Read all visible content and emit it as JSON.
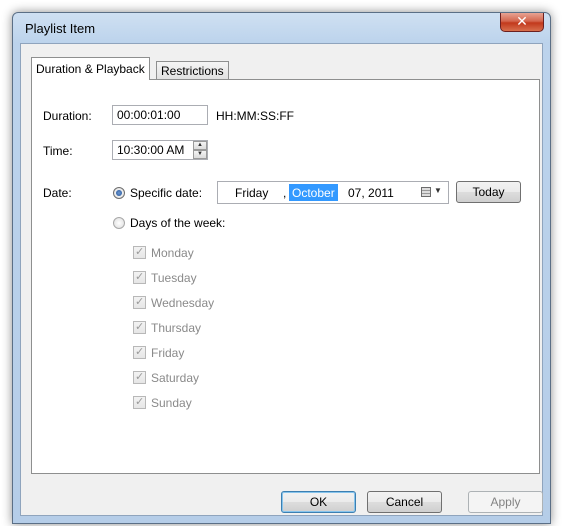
{
  "window": {
    "title": "Playlist Item"
  },
  "tabs": [
    {
      "label": "Duration & Playback",
      "active": true
    },
    {
      "label": "Restrictions",
      "active": false
    }
  ],
  "duration": {
    "label": "Duration:",
    "value": "00:00:01:00",
    "format_hint": "HH:MM:SS:FF"
  },
  "time": {
    "label": "Time:",
    "value": "10:30:00 AM"
  },
  "date": {
    "label": "Date:",
    "specific_option": {
      "label": "Specific date:",
      "checked": true
    },
    "picker": {
      "weekday": "Friday",
      "separator": ",",
      "month": "October",
      "day_year": "07, 2011"
    },
    "today_button": "Today",
    "days_option": {
      "label": "Days of the week:",
      "checked": false
    },
    "days": [
      {
        "label": "Monday",
        "checked": true
      },
      {
        "label": "Tuesday",
        "checked": true
      },
      {
        "label": "Wednesday",
        "checked": true
      },
      {
        "label": "Thursday",
        "checked": true
      },
      {
        "label": "Friday",
        "checked": true
      },
      {
        "label": "Saturday",
        "checked": true
      },
      {
        "label": "Sunday",
        "checked": true
      }
    ]
  },
  "footer": {
    "ok": "OK",
    "cancel": "Cancel",
    "apply": "Apply"
  },
  "icons": {
    "close": "close-icon",
    "calendar": "calendar-icon",
    "spin_up": "spin-up-icon",
    "spin_down": "spin-down-icon",
    "check": "check-icon"
  },
  "colors": {
    "selection": "#3399ff",
    "title_bar": "#bcd3ec",
    "close_button": "#c2391c"
  }
}
